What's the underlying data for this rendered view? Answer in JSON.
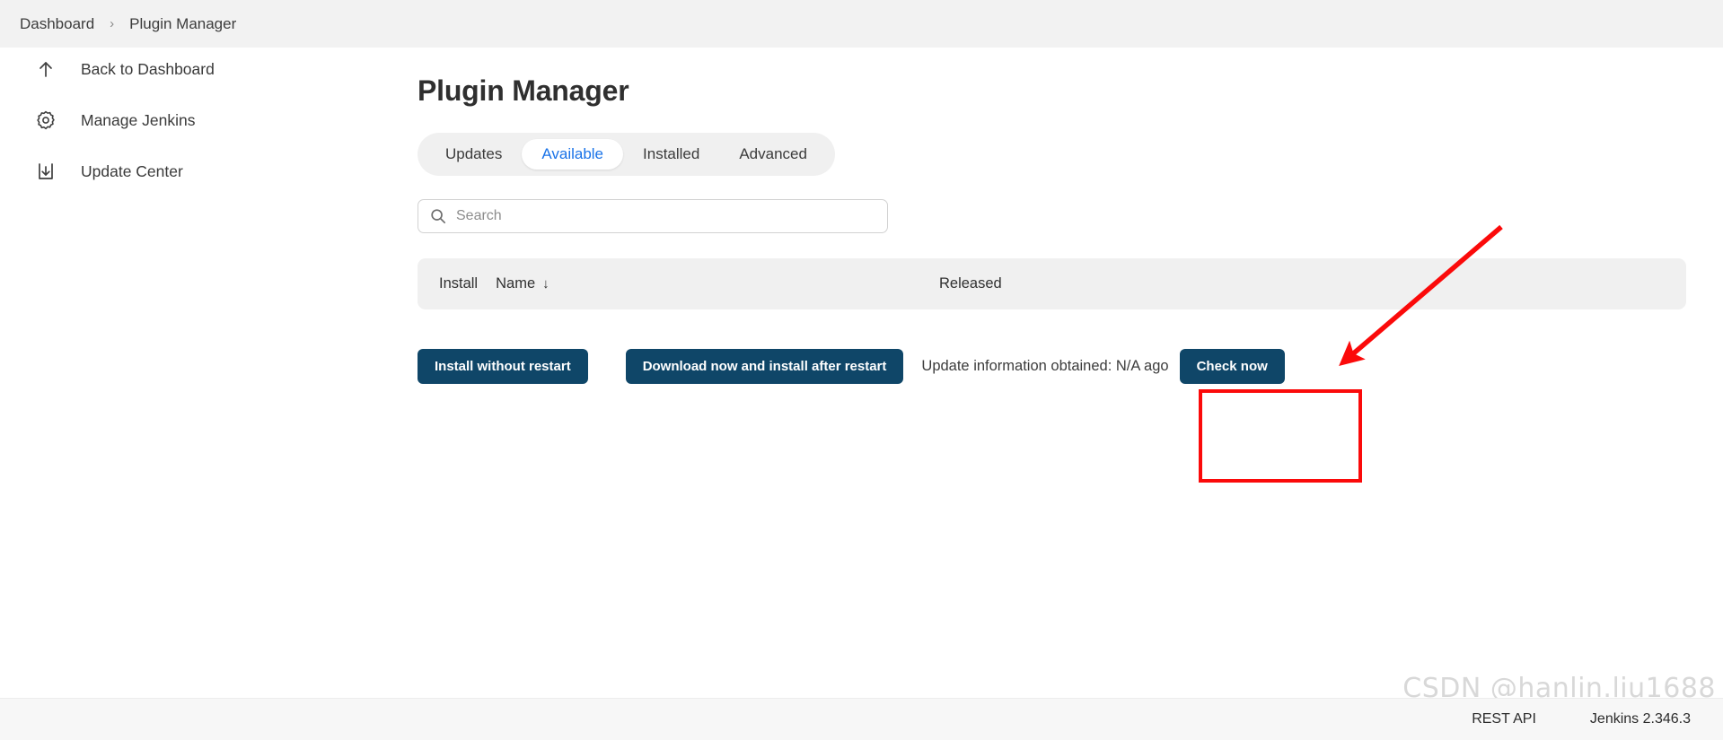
{
  "breadcrumb": {
    "items": [
      {
        "label": "Dashboard"
      },
      {
        "label": "Plugin Manager"
      }
    ],
    "separator": "›"
  },
  "sidebar": {
    "items": [
      {
        "label": "Back to Dashboard",
        "icon": "arrow-up-icon"
      },
      {
        "label": "Manage Jenkins",
        "icon": "gear-icon"
      },
      {
        "label": "Update Center",
        "icon": "download-icon"
      }
    ]
  },
  "main": {
    "title": "Plugin Manager",
    "tabs": [
      {
        "label": "Updates",
        "active": false
      },
      {
        "label": "Available",
        "active": true
      },
      {
        "label": "Installed",
        "active": false
      },
      {
        "label": "Advanced",
        "active": false
      }
    ],
    "search": {
      "placeholder": "Search",
      "value": "",
      "icon": "search-icon"
    },
    "table": {
      "columns": {
        "install": "Install",
        "name": "Name",
        "sort_indicator": "↓",
        "released": "Released"
      },
      "rows": []
    },
    "actions": {
      "install_without_restart": "Install without restart",
      "download_install_after_restart": "Download now and install after restart",
      "update_status": "Update information obtained: N/A ago",
      "check_now": "Check now"
    }
  },
  "footer": {
    "rest_api": "REST API",
    "version": "Jenkins 2.346.3"
  },
  "watermark": {
    "text": "CSDN @hanlin.liu1688"
  },
  "colors": {
    "accent_blue": "#1a73e8",
    "button_navy": "#0f4668",
    "annotation_red": "#fb0a0a",
    "topbar_bg": "#f2f2f2",
    "panel_bg": "#f0f0f0"
  }
}
